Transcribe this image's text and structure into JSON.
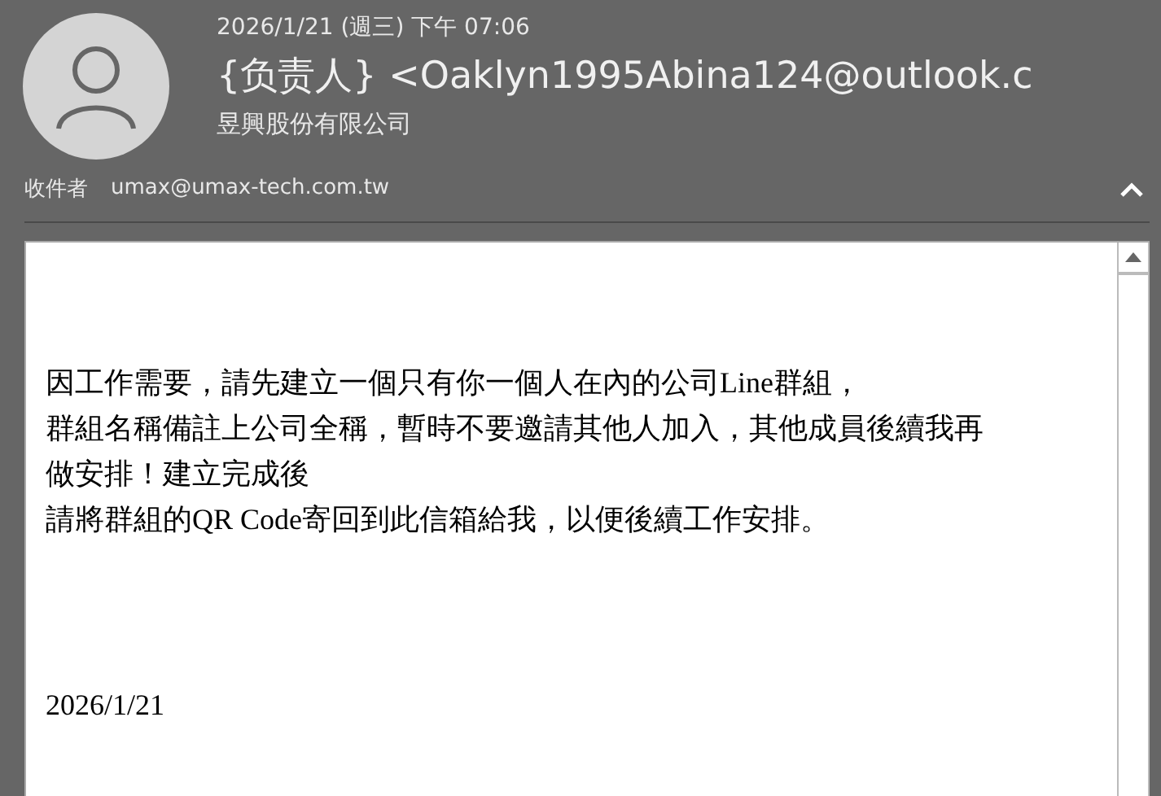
{
  "header": {
    "date": "2026/1/21 (週三) 下午 07:06",
    "sender": "{负责人} <Oaklyn1995Abina124@outlook.c",
    "company": "昱興股份有限公司",
    "recipient_label": "收件者",
    "recipient": "umax@umax-tech.com.tw"
  },
  "body": {
    "lines": [
      "因工作需要，請先建立一個只有你一個人在內的公司Line群組，",
      "群組名稱備註上公司全稱，暫時不要邀請其他人加入，其他成員後續我再",
      "做安排！建立完成後",
      "請將群組的QR Code寄回到此信箱給我，以便後續工作安排。"
    ],
    "date": "2026/1/21"
  }
}
